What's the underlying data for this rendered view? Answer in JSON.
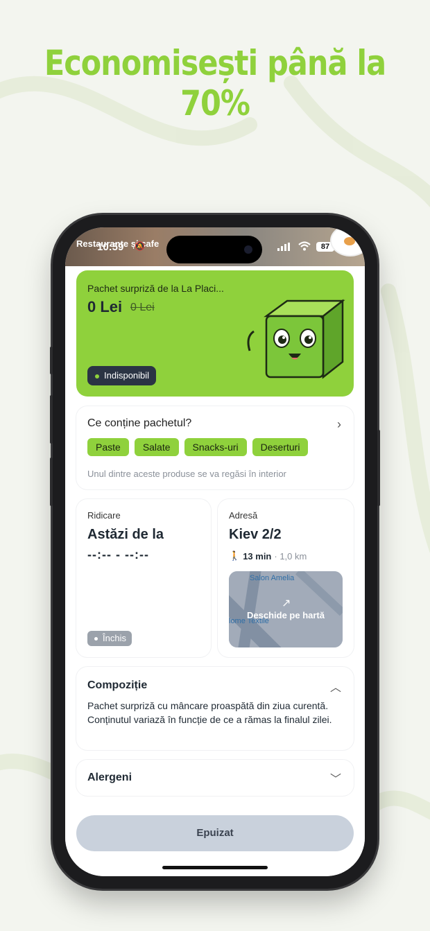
{
  "promo": {
    "headline": "Economisești până la 70%"
  },
  "status_bar": {
    "time": "10:59",
    "battery": "87",
    "app_header": "Restaurante și cafe"
  },
  "offer": {
    "title": "Pachet surpriză de la La Placi...",
    "price": "0 Lei",
    "old_price": "0 Lei",
    "status": "Indisponibil"
  },
  "contents": {
    "title": "Ce conține pachetul?",
    "chips": [
      "Paste",
      "Salate",
      "Snacks-uri",
      "Deserturi"
    ],
    "note": "Unul dintre aceste produse se va regăsi în interior"
  },
  "pickup": {
    "label": "Ridicare",
    "value": "Astăzi de la",
    "time": "--:-- - --:--",
    "status": "Închis"
  },
  "address": {
    "label": "Adresă",
    "value": "Kiev 2/2",
    "walk_time": "13 min",
    "distance": "· 1,0 km",
    "map_label_top": "Salon Amelia",
    "map_label_left": "lome Textile",
    "map_action": "Deschide pe hartă"
  },
  "composition": {
    "title": "Compoziție",
    "text": "Pachet surpriză cu mâncare proaspătă din ziua curentă. Conținutul variază în funcție de ce a rămas la finalul zilei."
  },
  "allergens": {
    "title": "Alergeni"
  },
  "cta": {
    "label": "Epuizat"
  },
  "colors": {
    "accent": "#8fd13c",
    "dark": "#2b3444",
    "disabled": "#c9d1dc"
  }
}
